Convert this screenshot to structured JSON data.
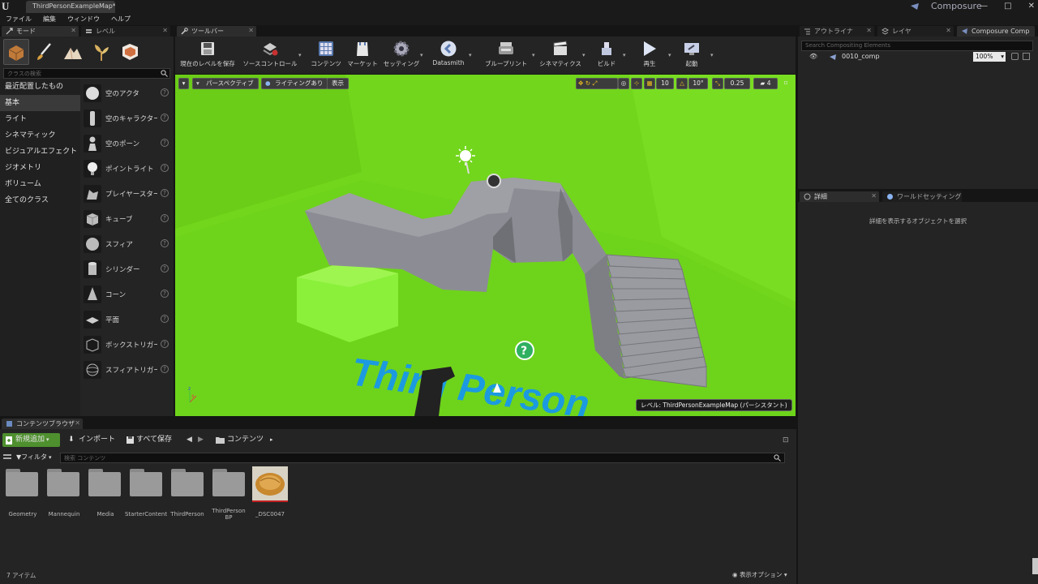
{
  "window": {
    "tab_title": "ThirdPersonExampleMap*",
    "project_name": "Composure",
    "controls": [
      "—",
      "□",
      "✕"
    ]
  },
  "menu": [
    "ファイル",
    "編集",
    "ウィンドウ",
    "ヘルプ"
  ],
  "left_tabs": {
    "modes": "モード",
    "levels": "レベル"
  },
  "modes": {
    "search_placeholder": "クラスの検索",
    "categories": [
      "最近配置したもの",
      "基本",
      "ライト",
      "シネマティック",
      "ビジュアルエフェクト",
      "ジオメトリ",
      "ボリューム",
      "全てのクラス"
    ],
    "selected_category": "基本",
    "items": [
      "空のアクタ",
      "空のキャラクター",
      "空のポーン",
      "ポイントライト",
      "プレイヤースター",
      "キューブ",
      "スフィア",
      "シリンダー",
      "コーン",
      "平面",
      "ボックストリガー",
      "スフィアトリガー"
    ]
  },
  "toolbar": {
    "tab_label": "ツールバー",
    "buttons": [
      "現在のレベルを保存",
      "ソースコントロール",
      "コンテンツ",
      "マーケット",
      "セッティング",
      "Datasmith",
      "ブループリント",
      "シネマティクス",
      "ビルド",
      "再生",
      "起動"
    ]
  },
  "viewport": {
    "perspective": "パースペクティブ",
    "lighting": "ライティングあり",
    "show": "表示",
    "grid_snap": "10",
    "rotation_snap": "10°",
    "scale_snap": "0.25",
    "camera_speed": "4",
    "level_label": "レベル:  ThirdPersonExampleMap (パーシスタント)",
    "floor_text": "Third Person"
  },
  "outliner": {
    "tabs": [
      "アウトライナ",
      "レイヤ",
      "Composure Comp"
    ],
    "search_placeholder": "Search Compositing Elements",
    "item": "0010_comp",
    "zoom": "100%"
  },
  "details": {
    "tabs": [
      "詳細",
      "ワールドセッティング"
    ],
    "empty_message": "詳細を表示するオブジェクトを選択"
  },
  "content_browser": {
    "tab_label": "コンテンツブラウザ",
    "add_new": "新規追加",
    "import": "インポート",
    "save_all": "すべて保存",
    "path": "コンテンツ",
    "filters": "フィルタ",
    "search_placeholder": "検索 コンテンツ",
    "assets": [
      "Geometry",
      "Mannequin",
      "Media",
      "StarterContent",
      "ThirdPerson",
      "ThirdPerson BP",
      "_DSC0047"
    ],
    "item_count": "7 アイテム",
    "view_options": "表示オプション"
  },
  "colors": {
    "background": "#242424",
    "viewport_green": "#6fd91c",
    "accent_green": "#5a9e3a",
    "floor_text_blue": "#1c9ae0"
  }
}
